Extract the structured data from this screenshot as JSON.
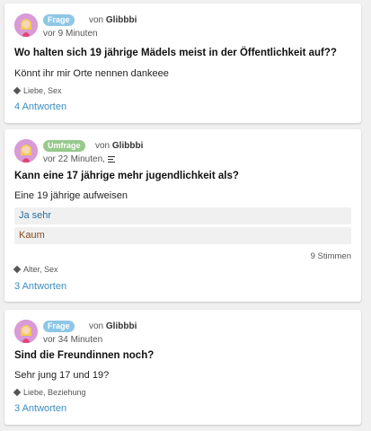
{
  "posts": [
    {
      "badge": "Frage",
      "by_prefix": "von",
      "author": "Glibbbi",
      "time": "vor 9 Minuten",
      "title": "Wo halten sich 19 jährige Mädels meist in der Öffentlichkeit auf??",
      "body": "Könnt ihr mir Orte nennen dankeee",
      "tags": "Liebe, Sex",
      "answers": "4 Antworten"
    },
    {
      "badge": "Umfrage",
      "by_prefix": "von",
      "author": "Glibbbi",
      "time": "vor 22 Minuten,",
      "title": "Kann eine 17 jährige mehr jugendlichkeit als?",
      "body": "Eine 19 jährige aufweisen",
      "poll_options": [
        "Ja sehr",
        "Kaum"
      ],
      "votes": "9 Stimmen",
      "tags": "Alter, Sex",
      "answers": "3 Antworten"
    },
    {
      "badge": "Frage",
      "by_prefix": "von",
      "author": "Glibbbi",
      "time": "vor 34 Minuten",
      "title": "Sind die Freundinnen noch?",
      "body": "Sehr jung  17 und 19?",
      "tags": "Liebe, Beziehung",
      "answers": "3 Antworten"
    }
  ],
  "colors": {
    "frage_badge": "#8ec7e6",
    "umfrage_badge": "#97c98c",
    "link": "#3a8ec4",
    "avatar_bg": "#d99ad8"
  }
}
